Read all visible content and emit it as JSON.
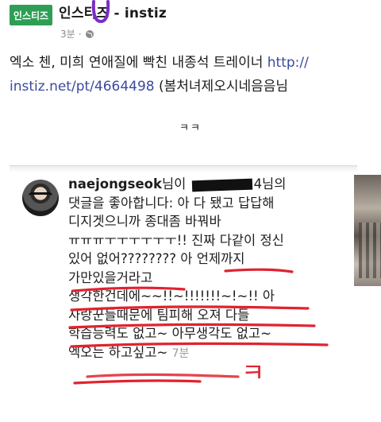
{
  "header": {
    "page_avatar_text": "인스티즈",
    "page_name": "인스티즈 - instiz",
    "time": "3분",
    "privacy_icon": "globe-icon"
  },
  "post": {
    "line1_text": "엑소 첸, 미희 연애질에 빡친 내종석 트레이너 ",
    "line1_link": "http://",
    "line2_link": "instiz.net/pt/4664498",
    "line2_text": " (봄처녀제오시네음음님",
    "kk": "ㅋㅋ"
  },
  "comment": {
    "username": "naejongseok",
    "line1_mid": "님이 ",
    "line1_end": "4님의",
    "line2": "댓글을 좋아합니다: 아 다 됐고 답답해",
    "line3": "디지겟으니까 종대좀 바꿔바",
    "line4": "ㅠㅠㅠㅜㅜㅜㅜㅜㅜ!! 진짜 다같이 정신",
    "line5": "있어 없어???????? 아 언제까지",
    "line6": "가만있을거라고",
    "line7": "생각한건데에~~!!~!!!!!!!~!~!! 아",
    "line8": "사랑꾼들때문에 팀피해 오져 다들",
    "line9": "학습능력도 없고~ 아무생각도 없고~",
    "line10": "엑오는 하고싶고~",
    "time": "7분",
    "annotation": "ㅋ"
  },
  "colors": {
    "avatar_green": "#2e9e55",
    "link_blue": "#3a4aa0",
    "annotation_red": "#e0232f",
    "scribble_purple": "#7a2cc9"
  }
}
